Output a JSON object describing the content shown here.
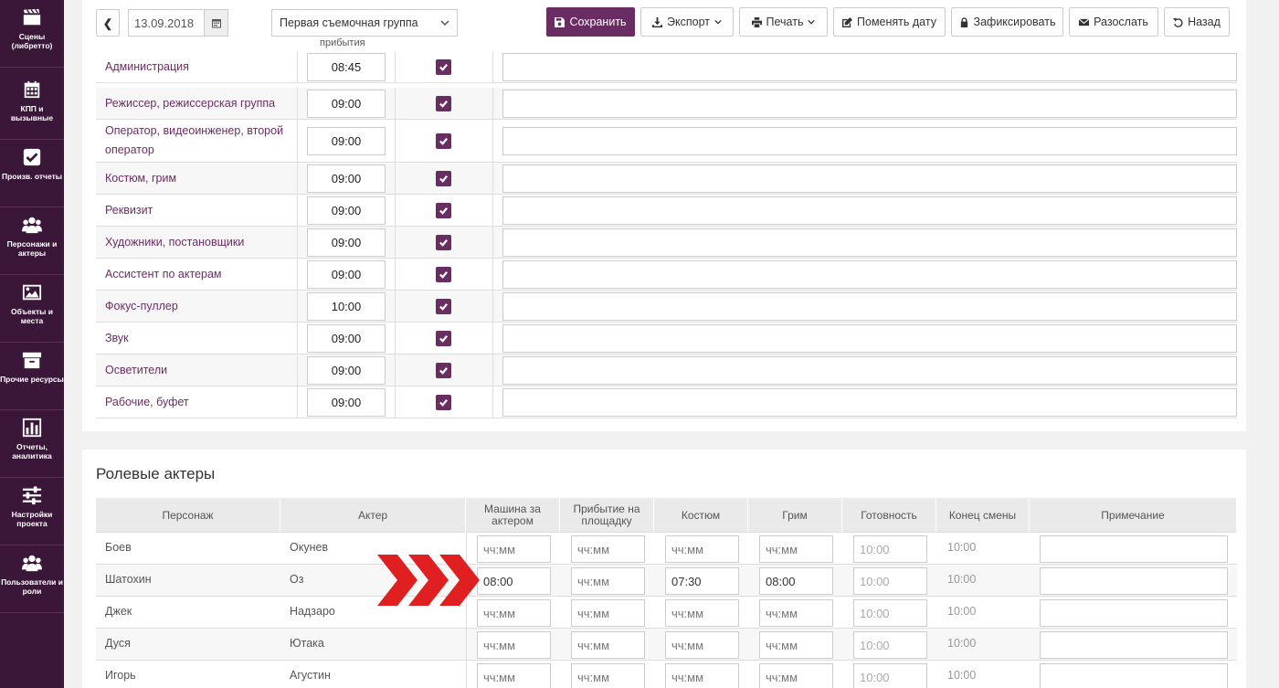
{
  "sidebar": {
    "items": [
      {
        "label": "Сцены (либретто)",
        "icon": "clapperboard-icon"
      },
      {
        "label": "КПП и вызывные",
        "icon": "calendar-icon"
      },
      {
        "label": "Произв. отчеты",
        "icon": "check-square-icon"
      },
      {
        "label": "Персонажи и актеры",
        "icon": "users-icon"
      },
      {
        "label": "Объекты и места",
        "icon": "image-icon"
      },
      {
        "label": "Прочие ресурсы",
        "icon": "archive-icon"
      },
      {
        "label": "Отчеты, аналитика",
        "icon": "bar-chart-icon"
      },
      {
        "label": "Настройки проекта",
        "icon": "sliders-icon"
      },
      {
        "label": "Пользователи и роли",
        "icon": "users-icon"
      }
    ]
  },
  "toolbar": {
    "back_glyph": "❮",
    "date": "13.09.2018",
    "group_select": "Первая съемочная группа",
    "save": "Сохранить",
    "export": "Экспорт",
    "print": "Печать",
    "change_date": "Поменять дату",
    "fix": "Зафиксировать",
    "send": "Разослать",
    "back": "Назад"
  },
  "departments": {
    "header_fragment": "прибытия",
    "rows": [
      {
        "name": "Администрация",
        "time": "08:45",
        "checked": true
      },
      {
        "name": "Режиссер, режиссерская группа",
        "time": "09:00",
        "checked": true
      },
      {
        "name": "Оператор, видеоинженер, второй оператор",
        "time": "09:00",
        "checked": true
      },
      {
        "name": "Костюм, грим",
        "time": "09:00",
        "checked": true
      },
      {
        "name": "Реквизит",
        "time": "09:00",
        "checked": true
      },
      {
        "name": "Художники, постановщики",
        "time": "09:00",
        "checked": true
      },
      {
        "name": "Ассистент по актерам",
        "time": "09:00",
        "checked": true
      },
      {
        "name": "Фокус-пуллер",
        "time": "10:00",
        "checked": true
      },
      {
        "name": "Звук",
        "time": "09:00",
        "checked": true
      },
      {
        "name": "Осветители",
        "time": "09:00",
        "checked": true
      },
      {
        "name": "Рабочие, буфет",
        "time": "09:00",
        "checked": true
      }
    ]
  },
  "actors": {
    "title": "Ролевые актеры",
    "columns": [
      "Персонаж",
      "Актер",
      "Машина за актером",
      "Прибытие на площадку",
      "Костюм",
      "Грим",
      "Готовность",
      "Конец смены",
      "Примечание"
    ],
    "placeholder": "чч:мм",
    "rows": [
      {
        "character": "Боев",
        "actor": "Окунев",
        "car": "",
        "arrival": "",
        "costume": "",
        "makeup": "",
        "ready": "10:00",
        "end": "10:00"
      },
      {
        "character": "Шатохин",
        "actor": "Оз",
        "car": "08:00",
        "arrival": "",
        "costume": "07:30",
        "makeup": "08:00",
        "ready": "10:00",
        "end": "10:00"
      },
      {
        "character": "Джек",
        "actor": "Надзаро",
        "car": "",
        "arrival": "",
        "costume": "",
        "makeup": "",
        "ready": "10:00",
        "end": "10:00"
      },
      {
        "character": "Дуся",
        "actor": "Ютака",
        "car": "",
        "arrival": "",
        "costume": "",
        "makeup": "",
        "ready": "10:00",
        "end": "10:00"
      },
      {
        "character": "Игорь",
        "actor": "Агустин",
        "car": "",
        "arrival": "",
        "costume": "",
        "makeup": "",
        "ready": "10:00",
        "end": "10:00"
      }
    ]
  },
  "colors": {
    "accent": "#6a2d63",
    "sidebar": "#3a1638",
    "arrow": "#e02020"
  }
}
